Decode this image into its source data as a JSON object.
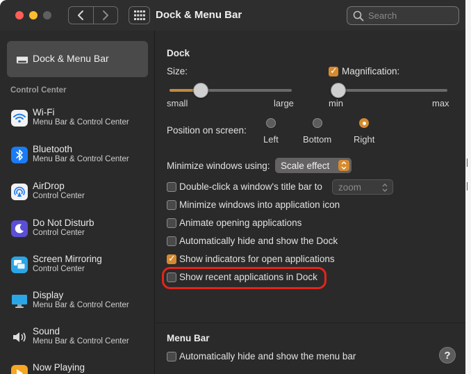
{
  "window": {
    "title": "Dock & Menu Bar",
    "search_placeholder": "Search"
  },
  "sidebar": {
    "selected": {
      "label": "Dock & Menu Bar",
      "icon": "dock-menubar-icon"
    },
    "section_label": "Control Center",
    "items": [
      {
        "name": "Wi-Fi",
        "sub": "Menu Bar & Control Center",
        "icon": "wifi-icon",
        "color": "#ffffff"
      },
      {
        "name": "Bluetooth",
        "sub": "Menu Bar & Control Center",
        "icon": "bluetooth-icon",
        "color": "#1a7cf5"
      },
      {
        "name": "AirDrop",
        "sub": "Control Center",
        "icon": "airdrop-icon",
        "color": "#ffffff"
      },
      {
        "name": "Do Not Disturb",
        "sub": "Control Center",
        "icon": "moon-icon",
        "color": "#5b4fd6"
      },
      {
        "name": "Screen Mirroring",
        "sub": "Control Center",
        "icon": "screen-mirroring-icon",
        "color": "#2aa6e6"
      },
      {
        "name": "Display",
        "sub": "Menu Bar & Control Center",
        "icon": "display-icon",
        "color": "#2aa6e6"
      },
      {
        "name": "Sound",
        "sub": "Menu Bar & Control Center",
        "icon": "speaker-icon",
        "color": "#dddddd"
      },
      {
        "name": "Now Playing",
        "sub": "",
        "icon": "now-playing-icon",
        "color": "#f5a623"
      }
    ]
  },
  "dock": {
    "section_title": "Dock",
    "size_label": "Size:",
    "size_min_label": "small",
    "size_max_label": "large",
    "size_value": 0.25,
    "magnification_label": "Magnification:",
    "magnification_checked": true,
    "mag_min_label": "min",
    "mag_max_label": "max",
    "mag_value": 0.0,
    "position_label": "Position on screen:",
    "positions": [
      "Left",
      "Bottom",
      "Right"
    ],
    "position_selected": "Right",
    "minimize_label": "Minimize windows using:",
    "minimize_value": "Scale effect",
    "options": [
      {
        "label": "Double-click a window's title bar to",
        "checked": false
      },
      {
        "label": "Minimize windows into application icon",
        "checked": false
      },
      {
        "label": "Animate opening applications",
        "checked": false
      },
      {
        "label": "Automatically hide and show the Dock",
        "checked": false
      },
      {
        "label": "Show indicators for open applications",
        "checked": true
      },
      {
        "label": "Show recent applications in Dock",
        "checked": false
      }
    ],
    "double_click_value": "zoom"
  },
  "menubar": {
    "section_title": "Menu Bar",
    "options": [
      {
        "label": "Automatically hide and show the menu bar",
        "checked": false
      }
    ]
  },
  "help_label": "?",
  "colors": {
    "accent": "#d68a2f",
    "highlight_ring": "#e3251b",
    "window_bg": "#2b2a2a"
  }
}
